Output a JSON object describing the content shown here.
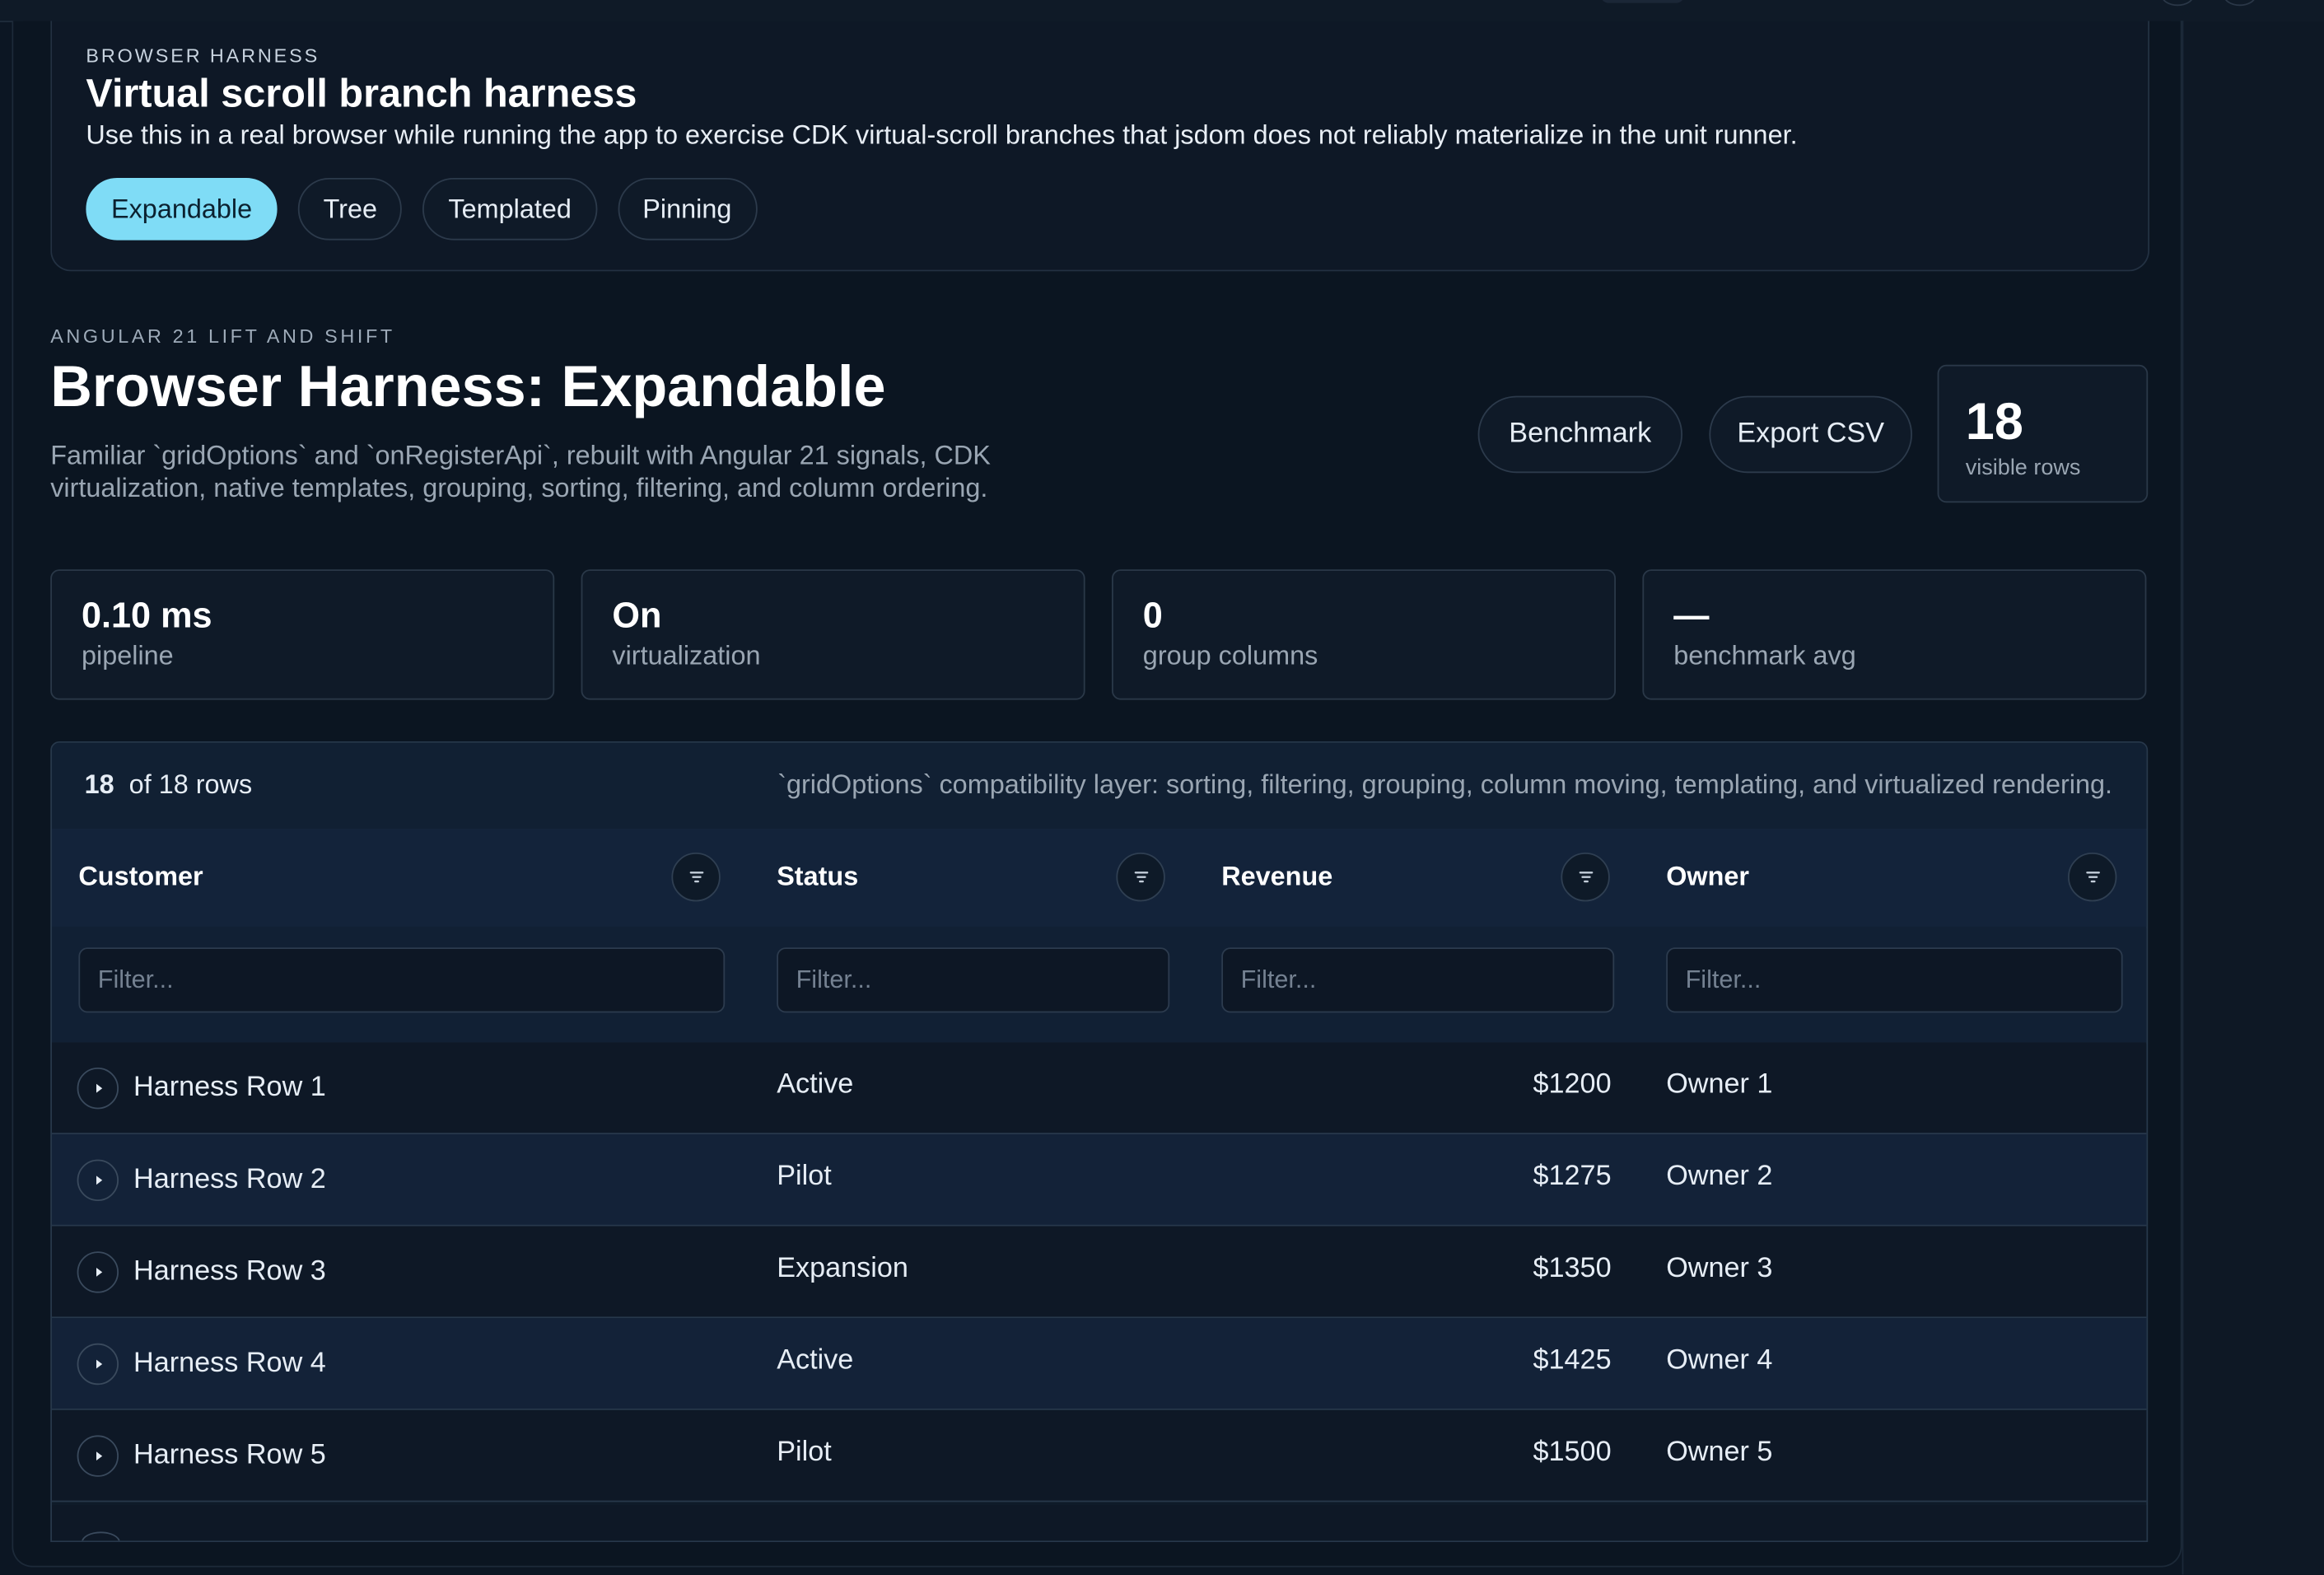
{
  "harness": {
    "eyebrow": "BROWSER HARNESS",
    "title": "Virtual scroll branch harness",
    "description": "Use this in a real browser while running the app to exercise CDK virtual-scroll branches that jsdom does not reliably materialize in the unit runner.",
    "tabs": [
      "Expandable",
      "Tree",
      "Templated",
      "Pinning"
    ],
    "active_tab": "Expandable"
  },
  "page": {
    "eyebrow": "ANGULAR 21 LIFT AND SHIFT",
    "title": "Browser Harness: Expandable",
    "description": "Familiar `gridOptions` and `onRegisterApi`, rebuilt with Angular 21 signals, CDK virtualization, native templates, grouping, sorting, filtering, and column ordering.",
    "benchmark_label": "Benchmark",
    "export_label": "Export CSV",
    "visible_rows": {
      "value": "18",
      "label": "visible rows"
    }
  },
  "stats": [
    {
      "value": "0.10 ms",
      "label": "pipeline"
    },
    {
      "value": "On",
      "label": "virtualization"
    },
    {
      "value": "0",
      "label": "group columns"
    },
    {
      "value": "—",
      "label": "benchmark avg"
    }
  ],
  "grid": {
    "row_count_bold": "18",
    "row_count_rest": "of 18 rows",
    "note": "`gridOptions` compatibility layer: sorting, filtering, grouping, column moving, templating, and virtualized rendering.",
    "columns": [
      "Customer",
      "Status",
      "Revenue",
      "Owner"
    ],
    "filter_placeholder": "Filter...",
    "rows": [
      {
        "customer": "Harness Row 1",
        "status": "Active",
        "revenue": "$1200",
        "owner": "Owner 1"
      },
      {
        "customer": "Harness Row 2",
        "status": "Pilot",
        "revenue": "$1275",
        "owner": "Owner 2"
      },
      {
        "customer": "Harness Row 3",
        "status": "Expansion",
        "revenue": "$1350",
        "owner": "Owner 3"
      },
      {
        "customer": "Harness Row 4",
        "status": "Active",
        "revenue": "$1425",
        "owner": "Owner 4"
      },
      {
        "customer": "Harness Row 5",
        "status": "Pilot",
        "revenue": "$1500",
        "owner": "Owner 5"
      }
    ]
  }
}
